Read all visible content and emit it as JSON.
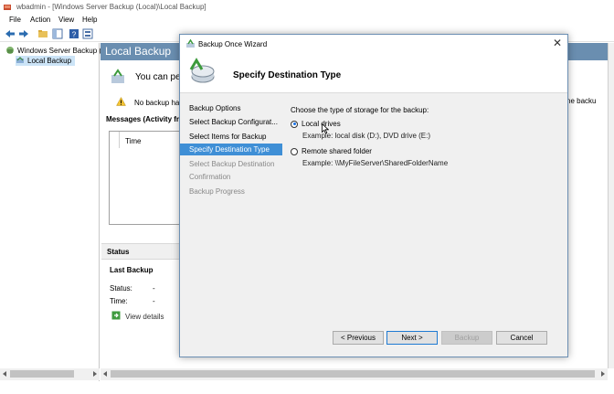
{
  "window": {
    "title": "wbadmin - [Windows Server Backup (Local)\\Local Backup]"
  },
  "menu": {
    "items": [
      "File",
      "Action",
      "View",
      "Help"
    ]
  },
  "tree": {
    "root": "Windows Server Backup (L",
    "child": "Local Backup"
  },
  "content": {
    "header": "Local Backup",
    "you_can": "You can pe",
    "no_backup": "No backup has",
    "messages_title": "Messages (Activity fro",
    "col_time": "Time",
    "right_fragment": "ne backu",
    "status_title": "Status",
    "last_backup": "Last Backup",
    "status_label": "Status:",
    "status_value": "-",
    "time_label": "Time:",
    "time_value": "-",
    "view_details": "View details"
  },
  "wizard": {
    "title": "Backup Once Wizard",
    "heading": "Specify Destination Type",
    "nav": [
      "Backup Options",
      "Select Backup Configurat...",
      "Select Items for Backup",
      "Specify Destination Type",
      "Select Backup Destination",
      "Confirmation",
      "Backup Progress"
    ],
    "prompt": "Choose the type of storage for the backup:",
    "options": [
      {
        "label": "Local drives",
        "example": "Example: local disk (D:), DVD drive (E:)",
        "selected": true
      },
      {
        "label": "Remote shared folder",
        "example": "Example: \\\\MyFileServer\\SharedFolderName",
        "selected": false
      }
    ],
    "buttons": {
      "previous": "< Previous",
      "next": "Next >",
      "backup": "Backup",
      "cancel": "Cancel"
    },
    "colors": {
      "active_nav": "#3f8fd6",
      "header_bar": "#6a8eb0"
    }
  }
}
